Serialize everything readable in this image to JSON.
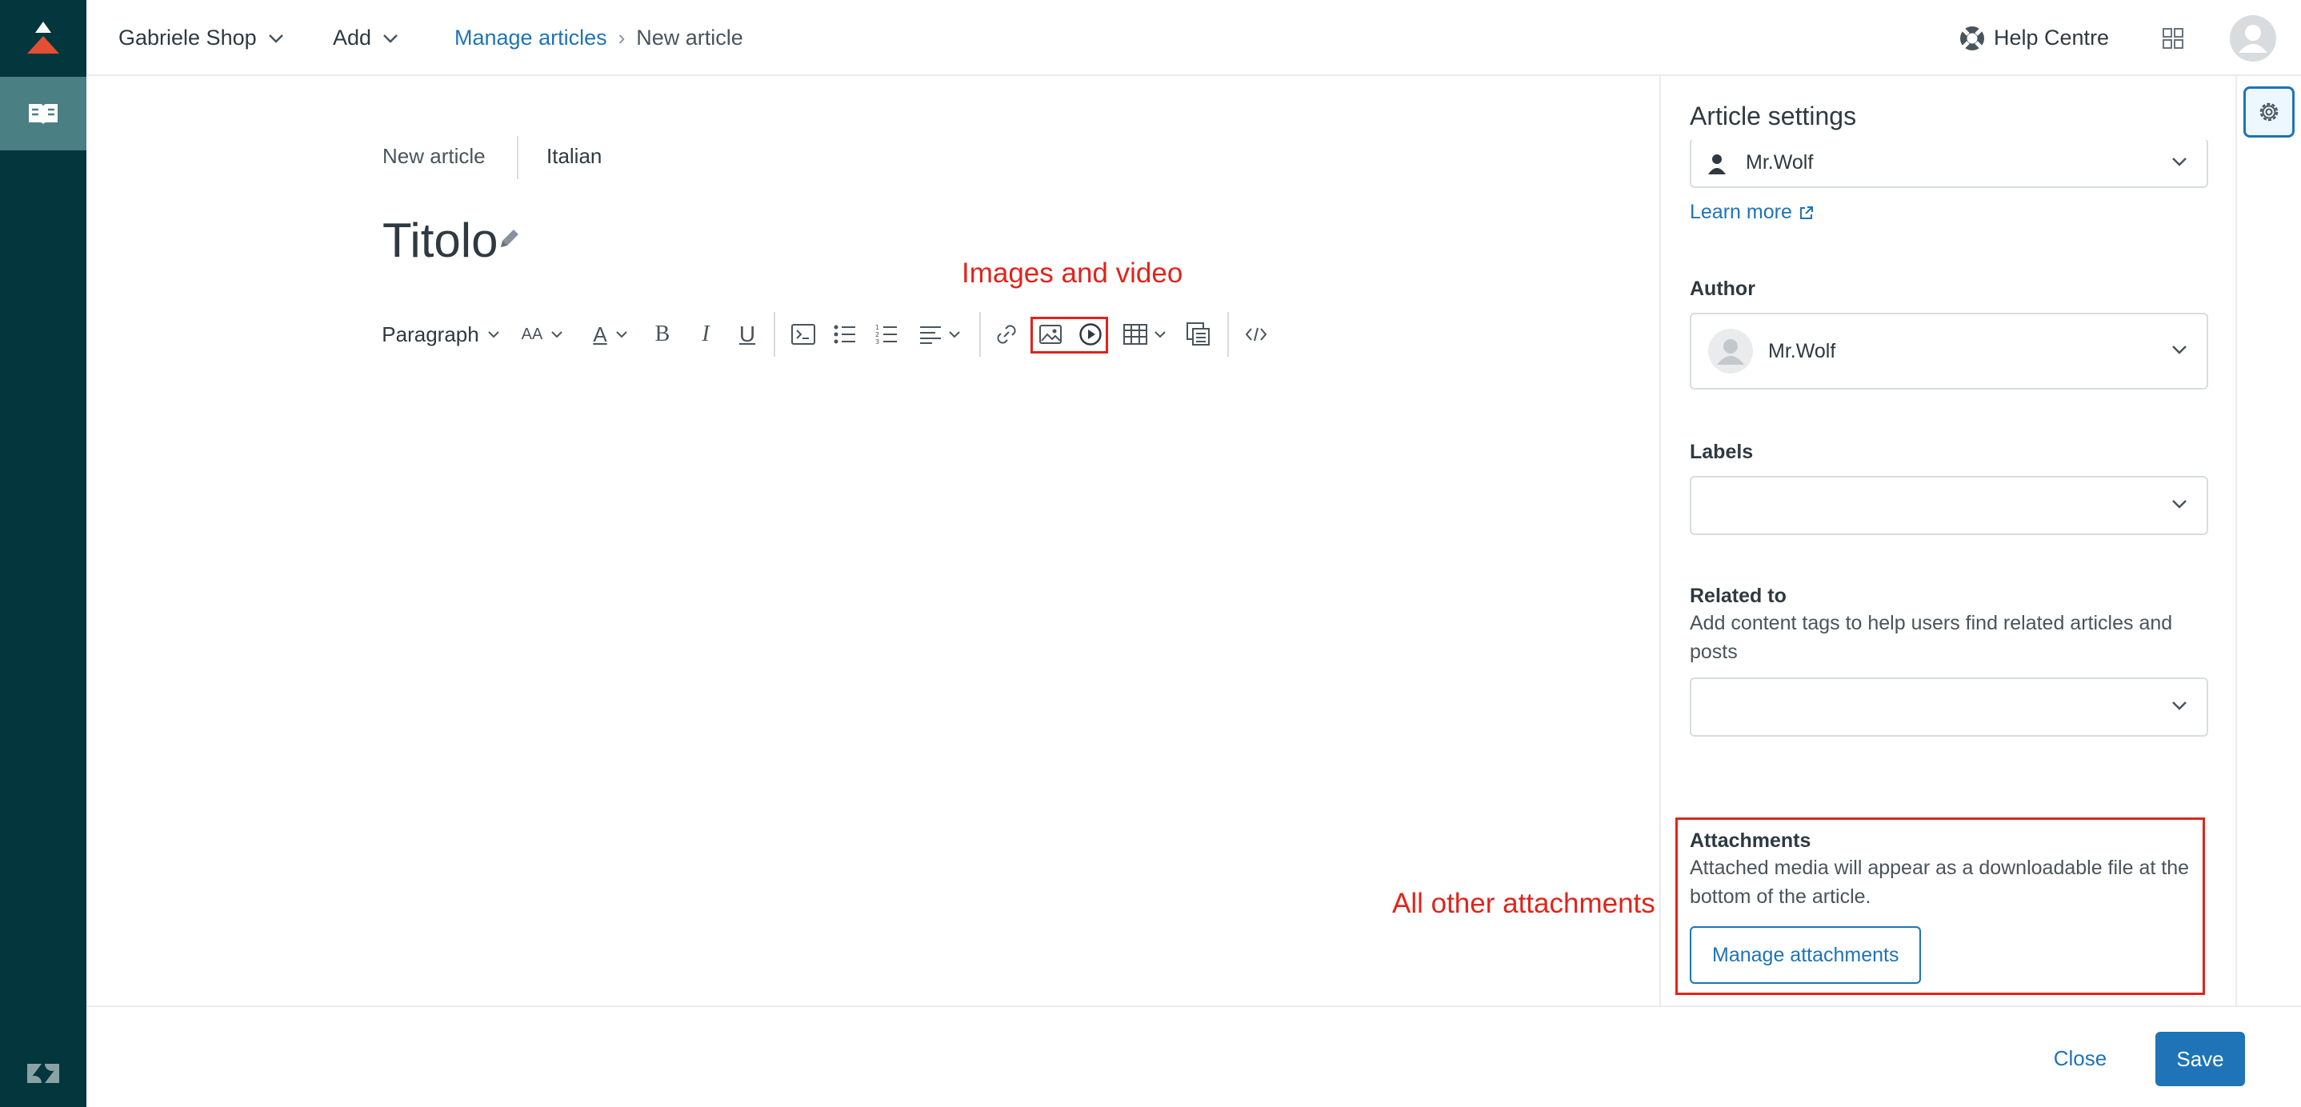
{
  "header": {
    "brand_menu": "Gabriele Shop",
    "add_menu": "Add",
    "breadcrumb": {
      "parent": "Manage articles",
      "separator": "›",
      "current": "New article"
    },
    "help_centre": "Help Centre"
  },
  "editor": {
    "tabs": [
      "New article",
      "Italian"
    ],
    "title": "Titolo",
    "toolbar": {
      "paragraph_label": "Paragraph",
      "font_size_label": "AA",
      "text_color_label": "A",
      "bold_label": "B",
      "italic_label": "I",
      "underline_label": "U"
    },
    "annotations": {
      "images_and_video": "Images and video",
      "all_other_attachments": "All other attachments"
    }
  },
  "settings": {
    "title": "Article settings",
    "owner_value": "Mr.Wolf",
    "learn_more": "Learn more",
    "author_label": "Author",
    "author_value": "Mr.Wolf",
    "labels_label": "Labels",
    "related_label": "Related to",
    "related_hint": "Add content tags to help users find related articles and posts",
    "attachments_label": "Attachments",
    "attachments_hint": "Attached media will appear as a downloadable file at the bottom of the article.",
    "manage_attachments": "Manage attachments"
  },
  "footer": {
    "close": "Close",
    "save": "Save"
  },
  "colors": {
    "rail": "#03363d",
    "rail_active": "#4a7f83",
    "accent": "#1f73b7",
    "annotation": "#e0241b",
    "logo_red": "#e34f32"
  },
  "icons": [
    "zendesk-logo-icon",
    "knowledge-book-icon",
    "help-lifebuoy-icon",
    "apps-grid-icon",
    "user-avatar-icon",
    "gear-icon",
    "pencil-icon",
    "code-block-icon",
    "bullet-list-icon",
    "numbered-list-icon",
    "align-icon",
    "link-icon",
    "image-icon",
    "video-play-icon",
    "table-icon",
    "blocks-icon",
    "source-code-icon"
  ]
}
